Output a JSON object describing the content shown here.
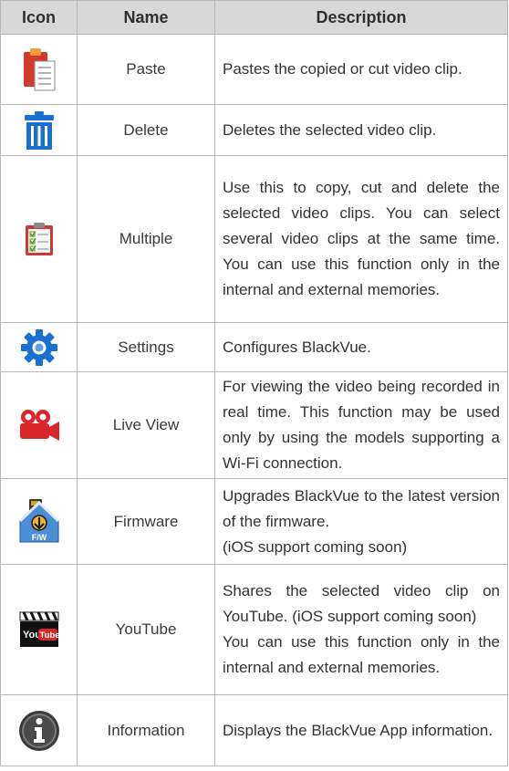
{
  "table": {
    "headers": {
      "icon": "Icon",
      "name": "Name",
      "description": "Description"
    },
    "rows": [
      {
        "icon": "paste-icon",
        "name": "Paste",
        "description": "Pastes the copied or cut video clip."
      },
      {
        "icon": "trash-icon",
        "name": "Delete",
        "description": "Deletes the selected video clip."
      },
      {
        "icon": "checklist-icon",
        "name": "Multiple",
        "description": "Use this to copy, cut and delete the selected video clips. You can select several video clips at the same time.  You can use this function only in the internal and external memories."
      },
      {
        "icon": "gear-icon",
        "name": "Settings",
        "description": "Configures BlackVue."
      },
      {
        "icon": "video-camera-icon",
        "name": "Live View",
        "description": "For viewing the video being recorded in real time. This function may be used only by using the models supporting a Wi-Fi connection."
      },
      {
        "icon": "firmware-icon",
        "name": "Firmware",
        "description": "Upgrades BlackVue to the latest version of the firmware.\n(iOS support coming soon)"
      },
      {
        "icon": "youtube-icon",
        "name": "YouTube",
        "description": "Shares the selected video clip on YouTube. (iOS support coming soon)\nYou can use this function only in the internal and external memories."
      },
      {
        "icon": "info-icon",
        "name": "Information",
        "description": "Displays the BlackVue App information."
      }
    ]
  },
  "icons": {
    "firmware_badge": "F/W",
    "youtube_you": "You",
    "youtube_tube": "Tube"
  },
  "colors": {
    "header_bg": "#d8d8d8",
    "border": "#b8b8b8",
    "text": "#333333",
    "icon_blue": "#1a6fd0",
    "icon_red": "#d9262b"
  }
}
